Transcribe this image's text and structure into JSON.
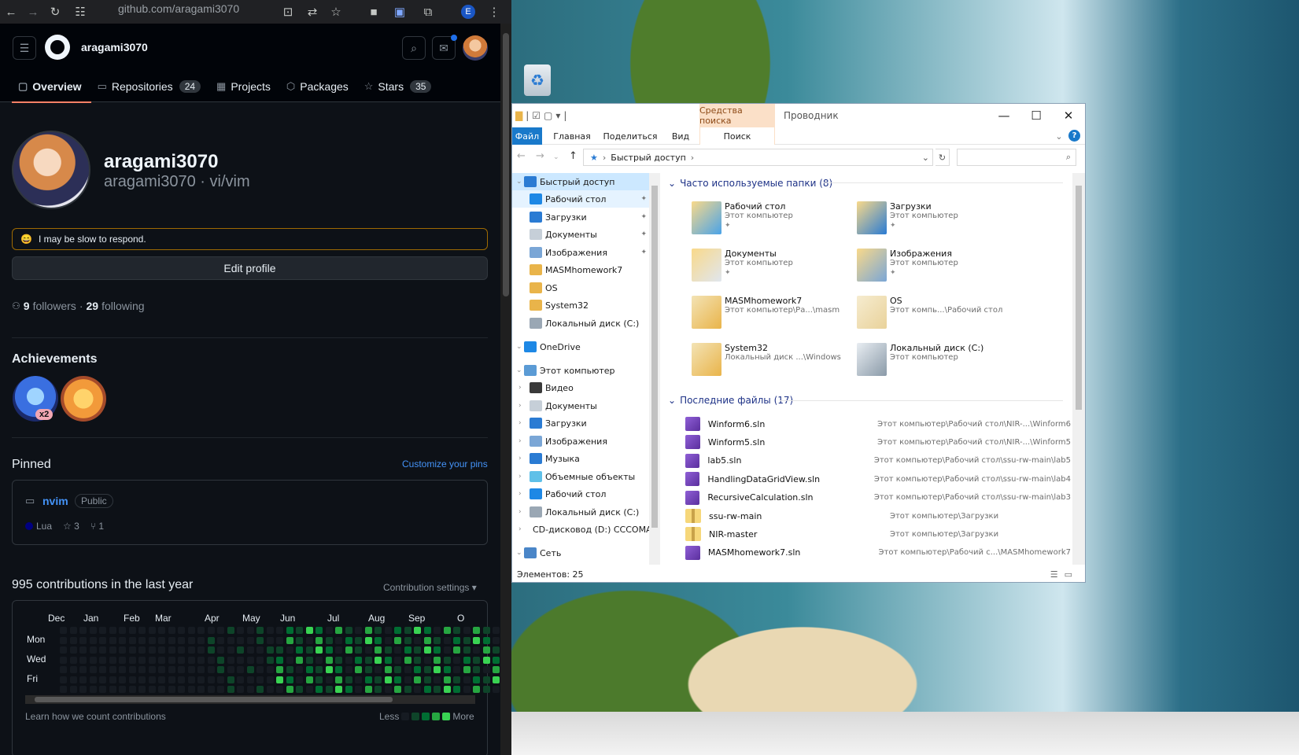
{
  "browser": {
    "url_host": "github.com/",
    "url_path": "aragami3070",
    "profile_initial": "E"
  },
  "github": {
    "header_user": "aragami3070",
    "tabs": [
      {
        "label": "Overview",
        "count": ""
      },
      {
        "label": "Repositories",
        "count": "24"
      },
      {
        "label": "Projects",
        "count": ""
      },
      {
        "label": "Packages",
        "count": ""
      },
      {
        "label": "Stars",
        "count": "35"
      }
    ],
    "profile": {
      "name": "aragami3070",
      "login_line": "aragami3070 · vi/vim",
      "status_emoji": "😄",
      "status_text": "I may be slow to respond.",
      "edit_label": "Edit profile",
      "followers_count": "9",
      "followers_label": "followers",
      "dot": "·",
      "following_count": "29",
      "following_label": "following"
    },
    "achievements": {
      "title": "Achievements",
      "multiplier": "x2"
    },
    "pinned": {
      "title": "Pinned",
      "customize": "Customize your pins",
      "repo": {
        "name": "nvim",
        "visibility": "Public",
        "language": "Lua",
        "stars": "3",
        "forks": "1"
      }
    },
    "contributions": {
      "title": "995 contributions in the last year",
      "settings": "Contribution settings",
      "months": [
        "Dec",
        "Jan",
        "Feb",
        "Mar",
        "Apr",
        "May",
        "Jun",
        "Jul",
        "Aug",
        "Sep",
        "O"
      ],
      "days": [
        "Mon",
        "Wed",
        "Fri"
      ],
      "learn": "Learn how we count contributions",
      "less": "Less",
      "more": "More",
      "colors": [
        "#161b22",
        "#0e4429",
        "#006d32",
        "#26a641",
        "#39d353"
      ]
    }
  },
  "explorer": {
    "context_tab": "Средства поиска",
    "app_title": "Проводник",
    "ribbon_tabs": [
      "Файл",
      "Главная",
      "Поделиться",
      "Вид",
      "Поиск"
    ],
    "address": {
      "root": "Быстрый доступ"
    },
    "nav": [
      {
        "label": "Быстрый доступ",
        "level": 0,
        "pin": false
      },
      {
        "label": "Рабочий стол",
        "level": 1,
        "pin": true
      },
      {
        "label": "Загрузки",
        "level": 1,
        "pin": true
      },
      {
        "label": "Документы",
        "level": 1,
        "pin": true
      },
      {
        "label": "Изображения",
        "level": 1,
        "pin": true
      },
      {
        "label": "MASMhomework7",
        "level": 1,
        "pin": false
      },
      {
        "label": "OS",
        "level": 1,
        "pin": false
      },
      {
        "label": "System32",
        "level": 1,
        "pin": false
      },
      {
        "label": "Локальный диск (C:)",
        "level": 1,
        "pin": false
      },
      {
        "label": "OneDrive",
        "level": 0,
        "pin": false
      },
      {
        "label": "Этот компьютер",
        "level": 0,
        "pin": false
      },
      {
        "label": "Видео",
        "level": 1,
        "pin": false
      },
      {
        "label": "Документы",
        "level": 1,
        "pin": false
      },
      {
        "label": "Загрузки",
        "level": 1,
        "pin": false
      },
      {
        "label": "Изображения",
        "level": 1,
        "pin": false
      },
      {
        "label": "Музыка",
        "level": 1,
        "pin": false
      },
      {
        "label": "Объемные объекты",
        "level": 1,
        "pin": false
      },
      {
        "label": "Рабочий стол",
        "level": 1,
        "pin": false
      },
      {
        "label": "Локальный диск (C:)",
        "level": 1,
        "pin": false
      },
      {
        "label": "CD-дисковод (D:) CCCOMA_X",
        "level": 1,
        "pin": false
      },
      {
        "label": "Сеть",
        "level": 0,
        "pin": false
      }
    ],
    "frequent_title": "Часто используемые папки (8)",
    "frequent": [
      {
        "name": "Рабочий стол",
        "path": "Этот компьютер",
        "pinned": true
      },
      {
        "name": "Загрузки",
        "path": "Этот компьютер",
        "pinned": true
      },
      {
        "name": "Документы",
        "path": "Этот компьютер",
        "pinned": true
      },
      {
        "name": "Изображения",
        "path": "Этот компьютер",
        "pinned": true
      },
      {
        "name": "MASMhomework7",
        "path": "Этот компьютер\\Ра...\\masm",
        "pinned": false
      },
      {
        "name": "OS",
        "path": "Этот компь...\\Рабочий стол",
        "pinned": false
      },
      {
        "name": "System32",
        "path": "Локальный диск ...\\Windows",
        "pinned": false
      },
      {
        "name": "Локальный диск (C:)",
        "path": "Этот компьютер",
        "pinned": false
      }
    ],
    "recent_title": "Последние файлы (17)",
    "recent": [
      {
        "name": "Winform6.sln",
        "path": "Этот компьютер\\Рабочий стол\\NIR-...\\Winform6",
        "kind": "sln"
      },
      {
        "name": "Winform5.sln",
        "path": "Этот компьютер\\Рабочий стол\\NIR-...\\Winform5",
        "kind": "sln"
      },
      {
        "name": "lab5.sln",
        "path": "Этот компьютер\\Рабочий стол\\ssu-rw-main\\lab5",
        "kind": "sln"
      },
      {
        "name": "HandlingDataGridView.sln",
        "path": "Этот компьютер\\Рабочий стол\\ssu-rw-main\\lab4",
        "kind": "sln"
      },
      {
        "name": "RecursiveCalculation.sln",
        "path": "Этот компьютер\\Рабочий стол\\ssu-rw-main\\lab3",
        "kind": "sln"
      },
      {
        "name": "ssu-rw-main",
        "path": "Этот компьютер\\Загрузки",
        "kind": "zip"
      },
      {
        "name": "NIR-master",
        "path": "Этот компьютер\\Загрузки",
        "kind": "zip"
      },
      {
        "name": "MASMhomework7.sln",
        "path": "Этот компьютер\\Рабочий с...\\MASMhomework7",
        "kind": "sln"
      }
    ],
    "status": "Элементов: 25"
  }
}
